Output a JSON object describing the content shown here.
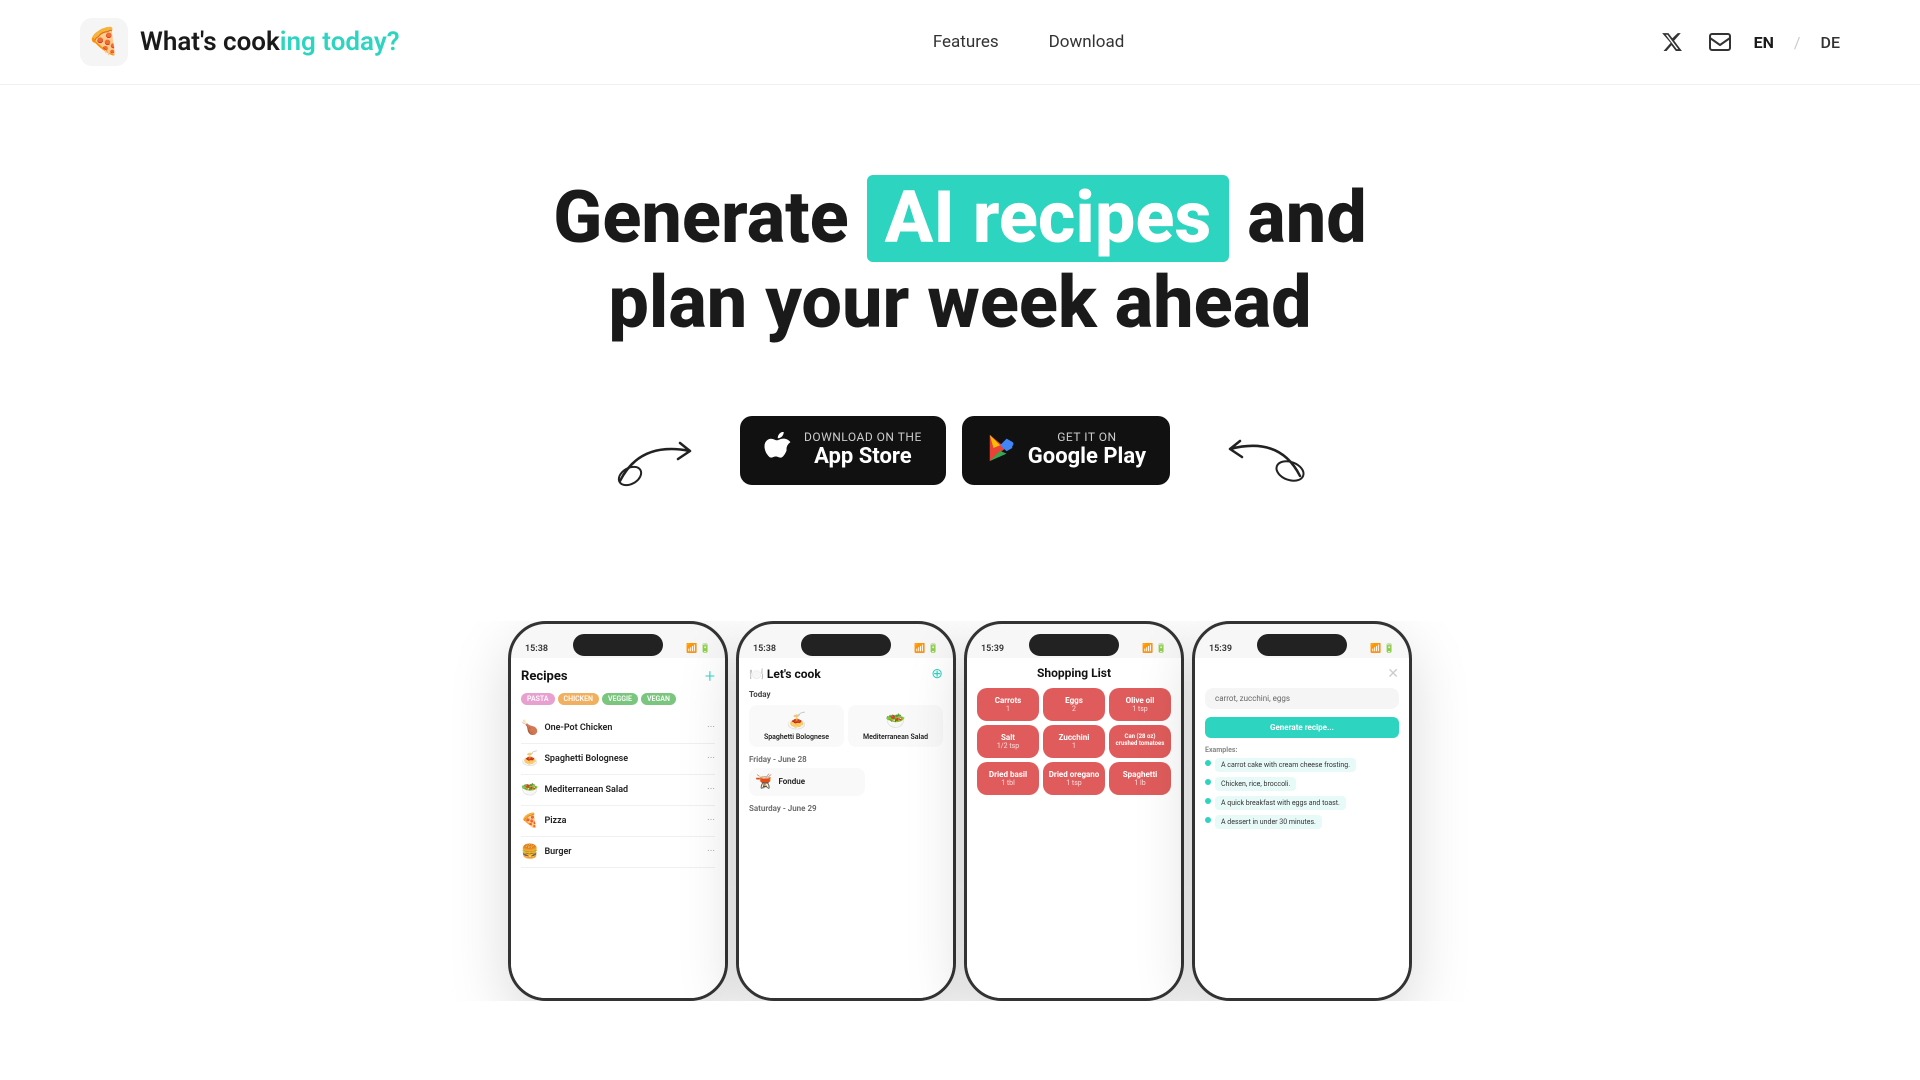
{
  "nav": {
    "logo_icon": "🍕",
    "logo_text_before": "What's cook",
    "logo_text_highlight": "ing today?",
    "links": [
      {
        "label": "Features",
        "id": "features"
      },
      {
        "label": "Download",
        "id": "download"
      }
    ],
    "lang_en": "EN",
    "lang_de": "DE"
  },
  "hero": {
    "line1_before": "Generate ",
    "line1_highlight": "AI recipes",
    "line1_after": " and",
    "line2": "plan your week ahead"
  },
  "cta": {
    "appstore_sub": "Download on the",
    "appstore_main": "App Store",
    "googleplay_sub": "GET IT ON",
    "googleplay_main": "Google Play"
  },
  "phones": [
    {
      "id": "recipes",
      "time": "15:38",
      "title": "Recipes",
      "tags": [
        "PASTA",
        "CHICKEN",
        "VEGGIE",
        "VEGAN"
      ],
      "items": [
        {
          "emoji": "🍗",
          "name": "One-Pot Chicken"
        },
        {
          "emoji": "🍝",
          "name": "Spaghetti Bolognese"
        },
        {
          "emoji": "🥗",
          "name": "Mediterranean Salad"
        },
        {
          "emoji": "🍕",
          "name": "Pizza"
        },
        {
          "emoji": "🍔",
          "name": "Burger"
        }
      ]
    },
    {
      "id": "letscook",
      "time": "15:38",
      "title": "🍽️ Let's cook",
      "section_today": "Today",
      "meals_today": [
        {
          "emoji": "🍝",
          "name": "Spaghetti Bolognese"
        },
        {
          "emoji": "🥗",
          "name": "Mediterranean Salad"
        }
      ],
      "section_friday": "Friday - June 28",
      "meals_friday": [
        {
          "emoji": "🫕",
          "name": "Fondue"
        }
      ],
      "section_saturday": "Saturday - June 29"
    },
    {
      "id": "shopping",
      "time": "15:39",
      "title": "Shopping List",
      "items": [
        {
          "name": "Carrots",
          "count": "1"
        },
        {
          "name": "Eggs",
          "count": "2"
        },
        {
          "name": "Olive oil",
          "count": "1 tsp"
        },
        {
          "name": "Salt",
          "count": "1/2 tsp"
        },
        {
          "name": "Zucchini",
          "count": "1"
        },
        {
          "name": "Can (28 oz) crushed tomatoes",
          "count": ""
        },
        {
          "name": "Dried basil",
          "count": "1 tbl"
        },
        {
          "name": "Dried oregano",
          "count": "1 tsp"
        },
        {
          "name": "Spaghetti",
          "count": "1 lb"
        }
      ]
    },
    {
      "id": "aigenerate",
      "time": "15:39",
      "input_placeholder": "carrot, zucchini, eggs",
      "generate_btn": "Generate recipe...",
      "examples_label": "Examples:",
      "examples": [
        "A carrot cake with cream cheese frosting.",
        "Chicken, rice, broccoli.",
        "A quick breakfast with eggs and toast.",
        "A dessert in under 30 minutes."
      ]
    }
  ]
}
